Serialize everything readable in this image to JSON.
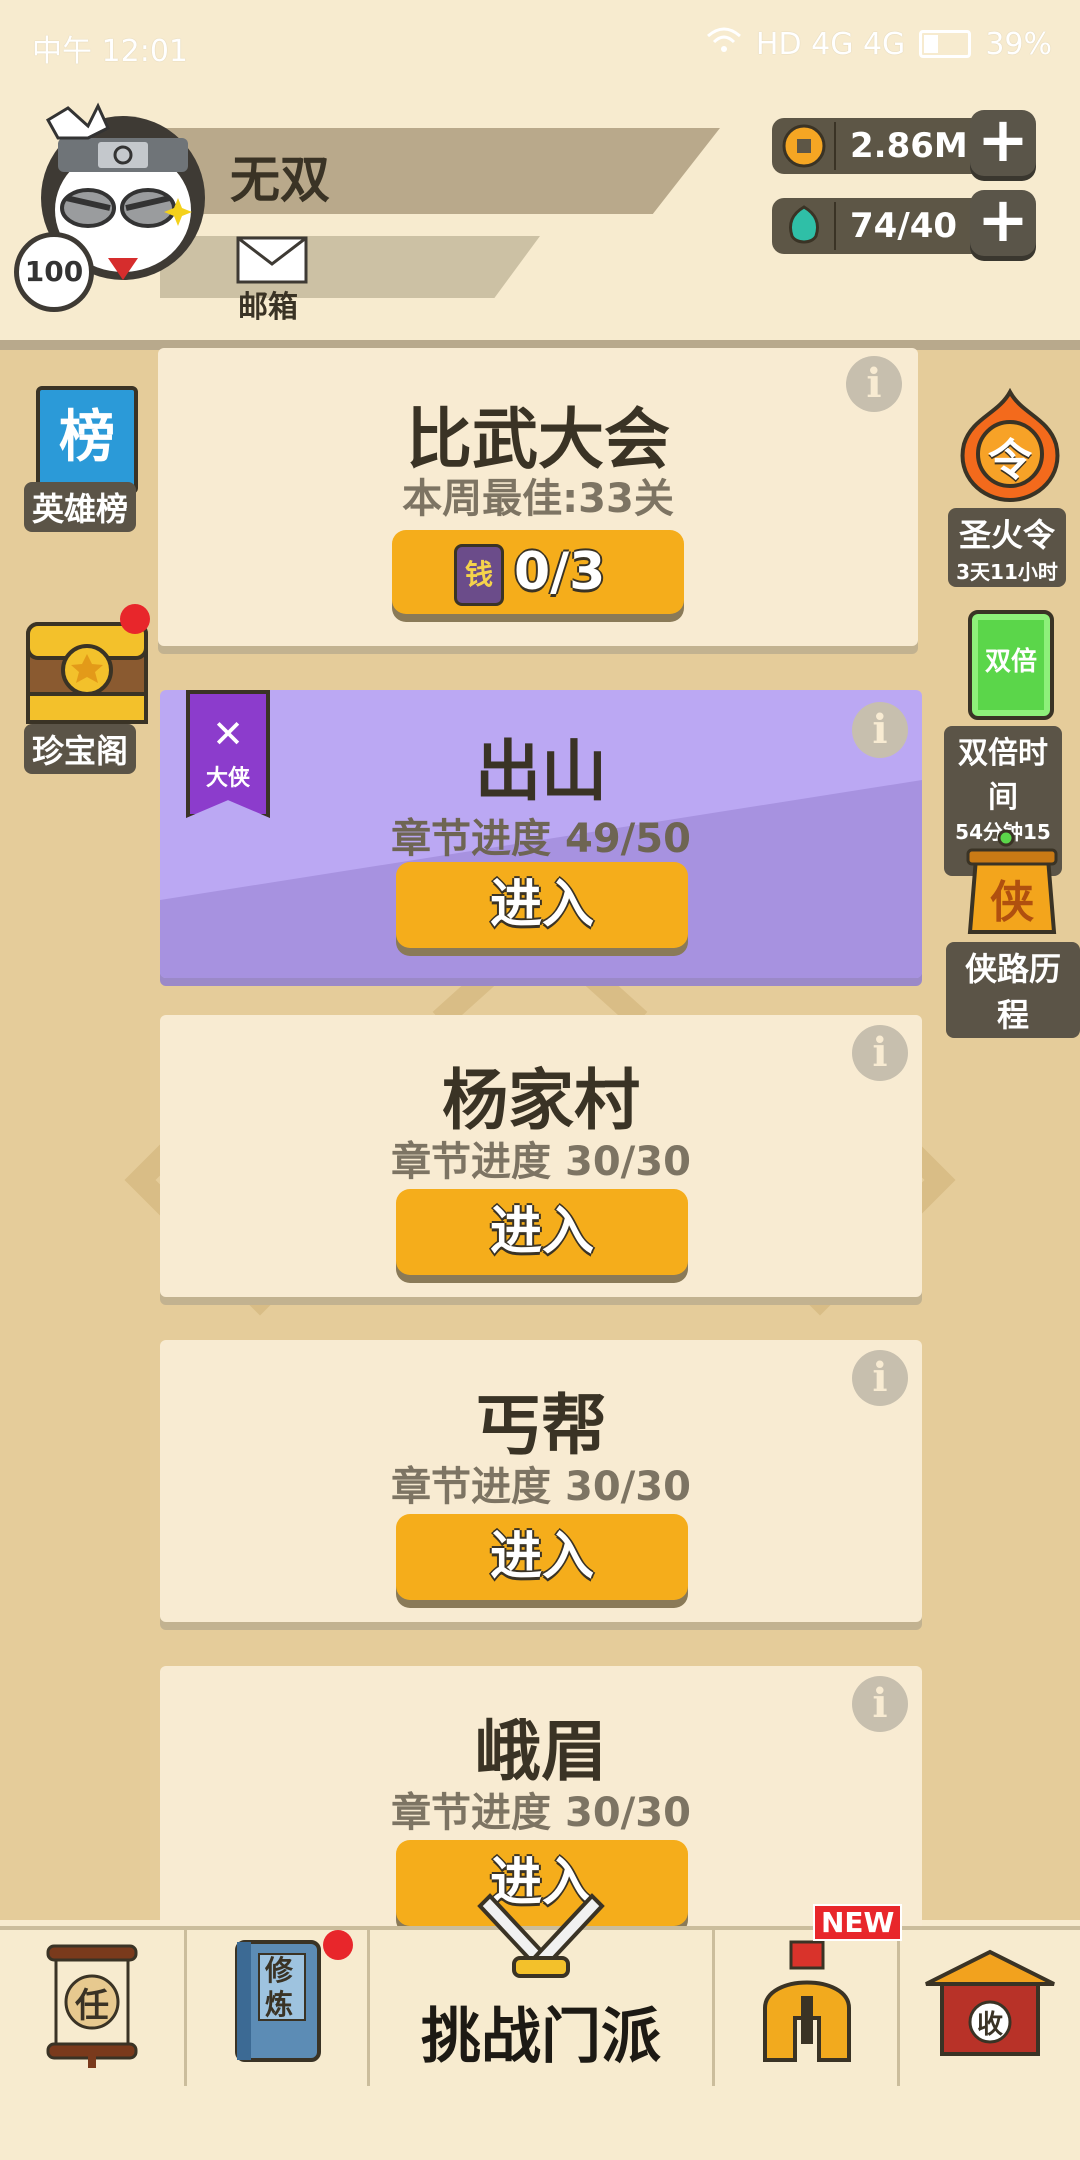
{
  "status_bar": {
    "time": "中午 12:01",
    "network": "HD 4G 4G",
    "battery": "39%"
  },
  "player": {
    "name": "无双",
    "level": "100",
    "mailbox_label": "邮箱"
  },
  "currencies": [
    {
      "name": "coin-icon",
      "value": "2.86M"
    },
    {
      "name": "gem-icon",
      "value": "74/40"
    }
  ],
  "left_sidebar": {
    "hero_rank": {
      "badge": "榜",
      "label": "英雄榜"
    },
    "treasure": {
      "label": "珍宝阁"
    }
  },
  "right_sidebar": {
    "holy_fire": {
      "badge": "令",
      "label": "圣火令",
      "timer": "3天11小时"
    },
    "double": {
      "badge": "双倍",
      "label": "双倍时间",
      "timer": "54分钟15秒"
    },
    "journey": {
      "badge": "侠",
      "label": "侠路历程"
    }
  },
  "tournament": {
    "title": "比武大会",
    "best": "本周最佳:33关",
    "ticket_icon": "钱",
    "attempts": "0/3"
  },
  "chapters": [
    {
      "title": "出山",
      "progress": "章节进度 49/50",
      "button": "进入",
      "ribbon": "大侠",
      "active": true
    },
    {
      "title": "杨家村",
      "progress": "章节进度 30/30",
      "button": "进入"
    },
    {
      "title": "丐帮",
      "progress": "章节进度 30/30",
      "button": "进入"
    },
    {
      "title": "峨眉",
      "progress": "章节进度 30/30",
      "button": "进入"
    }
  ],
  "bottom_nav": {
    "task": "任",
    "train": "修炼",
    "challenge": "挑战门派",
    "new_badge": "NEW",
    "collect": "收"
  },
  "colors": {
    "accent": "#f5ad1b",
    "card": "#f8ebd2",
    "active_card": "#bba8f3",
    "panel": "#e5cc9a"
  }
}
